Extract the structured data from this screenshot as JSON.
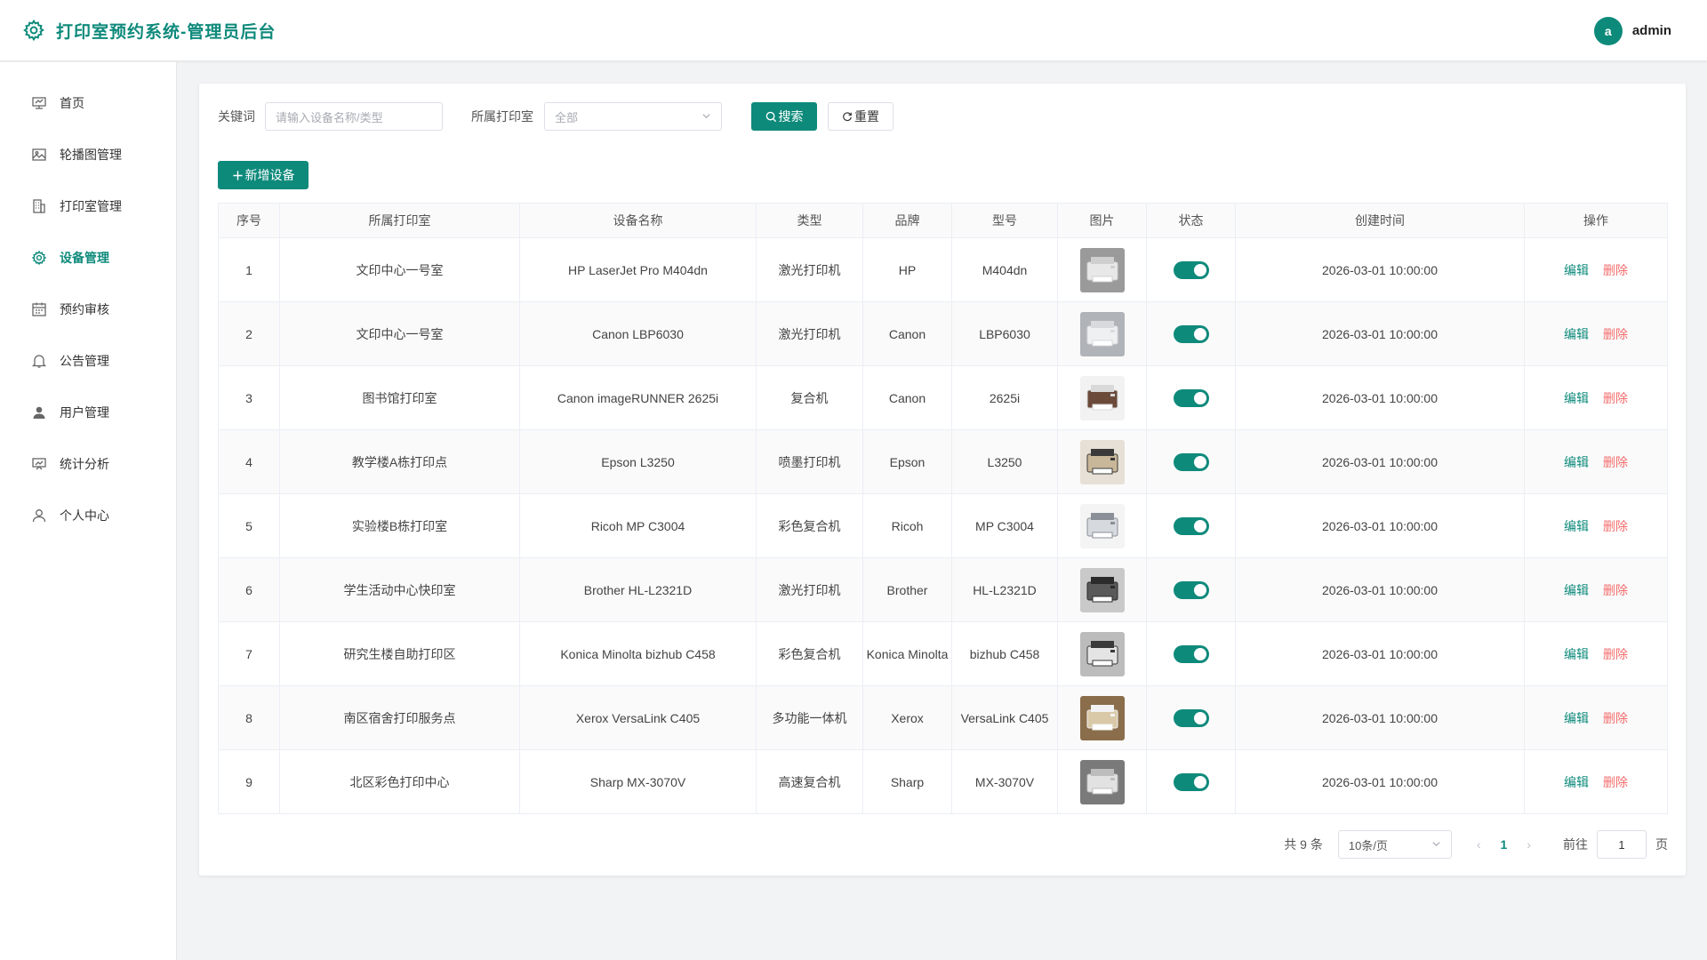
{
  "header": {
    "title": "打印室预约系统-管理员后台",
    "avatar_letter": "a",
    "username": "admin"
  },
  "sidebar": {
    "items": [
      {
        "label": "首页",
        "icon": "monitor-icon"
      },
      {
        "label": "轮播图管理",
        "icon": "image-icon"
      },
      {
        "label": "打印室管理",
        "icon": "building-icon"
      },
      {
        "label": "设备管理",
        "icon": "gear-icon",
        "active": true
      },
      {
        "label": "预约审核",
        "icon": "calendar-icon"
      },
      {
        "label": "公告管理",
        "icon": "bell-icon"
      },
      {
        "label": "用户管理",
        "icon": "user-filled-icon"
      },
      {
        "label": "统计分析",
        "icon": "chart-icon"
      },
      {
        "label": "个人中心",
        "icon": "user-icon"
      }
    ]
  },
  "filters": {
    "keyword_label": "关键词",
    "keyword_placeholder": "请输入设备名称/类型",
    "room_label": "所属打印室",
    "room_value": "全部",
    "search_label": "搜索",
    "reset_label": "重置"
  },
  "actions": {
    "add_label": "新增设备"
  },
  "table": {
    "headers": [
      "序号",
      "所属打印室",
      "设备名称",
      "类型",
      "品牌",
      "型号",
      "图片",
      "状态",
      "创建时间",
      "操作"
    ],
    "edit_label": "编辑",
    "delete_label": "删除",
    "rows": [
      {
        "no": "1",
        "room": "文印中心一号室",
        "name": "HP LaserJet Pro M404dn",
        "type": "激光打印机",
        "brand": "HP",
        "model": "M404dn",
        "status": true,
        "created": "2026-03-01 10:00:00"
      },
      {
        "no": "2",
        "room": "文印中心一号室",
        "name": "Canon LBP6030",
        "type": "激光打印机",
        "brand": "Canon",
        "model": "LBP6030",
        "status": true,
        "created": "2026-03-01 10:00:00"
      },
      {
        "no": "3",
        "room": "图书馆打印室",
        "name": "Canon imageRUNNER 2625i",
        "type": "复合机",
        "brand": "Canon",
        "model": "2625i",
        "status": true,
        "created": "2026-03-01 10:00:00"
      },
      {
        "no": "4",
        "room": "教学楼A栋打印点",
        "name": "Epson L3250",
        "type": "喷墨打印机",
        "brand": "Epson",
        "model": "L3250",
        "status": true,
        "created": "2026-03-01 10:00:00"
      },
      {
        "no": "5",
        "room": "实验楼B栋打印室",
        "name": "Ricoh MP C3004",
        "type": "彩色复合机",
        "brand": "Ricoh",
        "model": "MP C3004",
        "status": true,
        "created": "2026-03-01 10:00:00"
      },
      {
        "no": "6",
        "room": "学生活动中心快印室",
        "name": "Brother HL-L2321D",
        "type": "激光打印机",
        "brand": "Brother",
        "model": "HL-L2321D",
        "status": true,
        "created": "2026-03-01 10:00:00"
      },
      {
        "no": "7",
        "room": "研究生楼自助打印区",
        "name": "Konica Minolta bizhub C458",
        "type": "彩色复合机",
        "brand": "Konica Minolta",
        "model": "bizhub C458",
        "status": true,
        "created": "2026-03-01 10:00:00"
      },
      {
        "no": "8",
        "room": "南区宿舍打印服务点",
        "name": "Xerox VersaLink C405",
        "type": "多功能一体机",
        "brand": "Xerox",
        "model": "VersaLink C405",
        "status": true,
        "created": "2026-03-01 10:00:00"
      },
      {
        "no": "9",
        "room": "北区彩色打印中心",
        "name": "Sharp MX-3070V",
        "type": "高速复合机",
        "brand": "Sharp",
        "model": "MX-3070V",
        "status": true,
        "created": "2026-03-01 10:00:00"
      }
    ]
  },
  "pagination": {
    "total_text": "共 9 条",
    "page_size": "10条/页",
    "current_page": "1",
    "goto_label": "前往",
    "goto_value": "1",
    "page_suffix": "页"
  },
  "colors": {
    "accent": "#0e8a7b",
    "danger": "#f56c6c"
  }
}
